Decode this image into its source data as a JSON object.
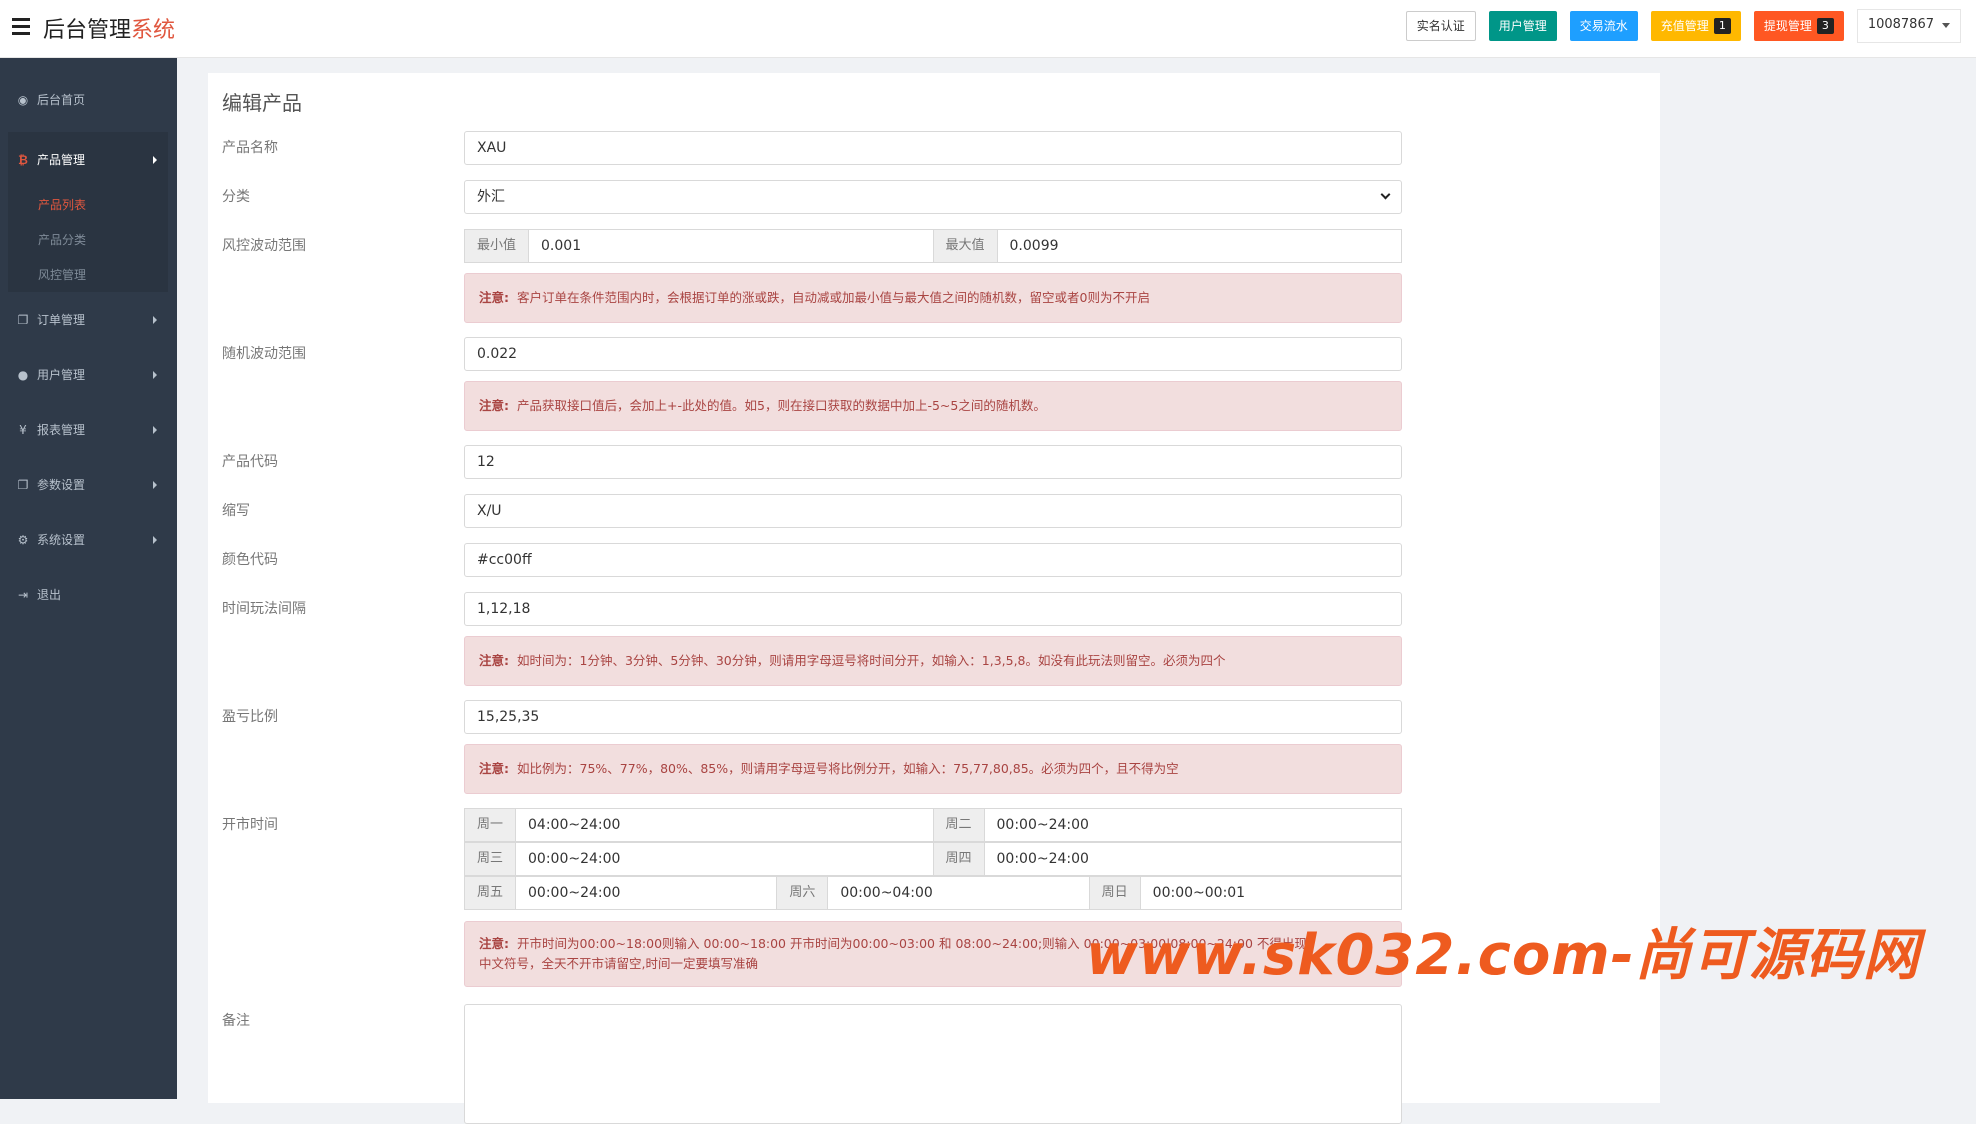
{
  "header": {
    "title_main": "后台管理",
    "title_accent": "系统",
    "buttons": [
      {
        "label": "实名认证",
        "color": "#ffffff"
      },
      {
        "label": "用户管理",
        "color": "#009688"
      },
      {
        "label": "交易流水",
        "color": "#1e9fff"
      },
      {
        "label": "充值管理",
        "color": "#ffb800",
        "badge": "1"
      },
      {
        "label": "提现管理",
        "color": "#ff5722",
        "badge": "3"
      }
    ],
    "user": "10087867"
  },
  "sidebar": {
    "items": [
      {
        "label": "后台首页",
        "icon": "dashboard-icon"
      },
      {
        "label": "产品管理",
        "icon": "bitcoin-icon",
        "expanded": true
      },
      {
        "label": "订单管理",
        "icon": "copy-icon"
      },
      {
        "label": "用户管理",
        "icon": "user-icon"
      },
      {
        "label": "报表管理",
        "icon": "yen-icon"
      },
      {
        "label": "参数设置",
        "icon": "copy-icon"
      },
      {
        "label": "系统设置",
        "icon": "gears-icon"
      },
      {
        "label": "退出",
        "icon": "sign-out-icon"
      }
    ],
    "sub_items": [
      "产品列表",
      "产品分类",
      "风控管理"
    ]
  },
  "form": {
    "title": "编辑产品",
    "name_label": "产品名称",
    "name_value": "XAU",
    "category_label": "分类",
    "category_value": "外汇",
    "risk_label": "风控波动范围",
    "risk_min_addon": "最小值",
    "risk_min_value": "0.001",
    "risk_max_addon": "最大值",
    "risk_max_value": "0.0099",
    "risk_note": "客户订单在条件范围内时，会根据订单的涨或跌，自动减或加最小值与最大值之间的随机数，留空或者0则为不开启",
    "random_label": "随机波动范围",
    "random_value": "0.022",
    "random_note": "产品获取接口值后，会加上+-此处的值。如5，则在接口获取的数据中加上-5~5之间的随机数。",
    "code_label": "产品代码",
    "code_value": "12",
    "abbr_label": "缩写",
    "abbr_value": "X/U",
    "color_label": "颜色代码",
    "color_value": "#cc00ff",
    "interval_label": "时间玩法间隔",
    "interval_value": "1,12,18",
    "interval_note": "如时间为：1分钟、3分钟、5分钟、30分钟，则请用字母逗号将时间分开，如输入：1,3,5,8。如没有此玩法则留空。必须为四个",
    "ratio_label": "盈亏比例",
    "ratio_value": "15,25,35",
    "ratio_note": "如比例为：75%、77%，80%、85%，则请用字母逗号将比例分开，如输入：75,77,80,85。必须为四个，且不得为空",
    "open_label": "开市时间",
    "schedule": [
      {
        "day": "周一",
        "time": "04:00~24:00"
      },
      {
        "day": "周二",
        "time": "00:00~24:00"
      },
      {
        "day": "周三",
        "time": "00:00~24:00"
      },
      {
        "day": "周四",
        "time": "00:00~24:00"
      },
      {
        "day": "周五",
        "time": "00:00~24:00"
      },
      {
        "day": "周六",
        "time": "00:00~04:00"
      },
      {
        "day": "周日",
        "time": "00:00~00:01"
      }
    ],
    "open_note_1": "开市时间为00:00~18:00则输入 00:00~18:00 开市时间为00:00~03:00 和 08:00~24:00;则输入 00:00~03:00|08:00~24:00 不得出现",
    "open_note_2": "中文符号，全天不开市请留空,时间一定要填写准确",
    "note_prefix": "注意:",
    "remark_label": "备注"
  },
  "watermark": "www.sk032.com-尚可源码网"
}
